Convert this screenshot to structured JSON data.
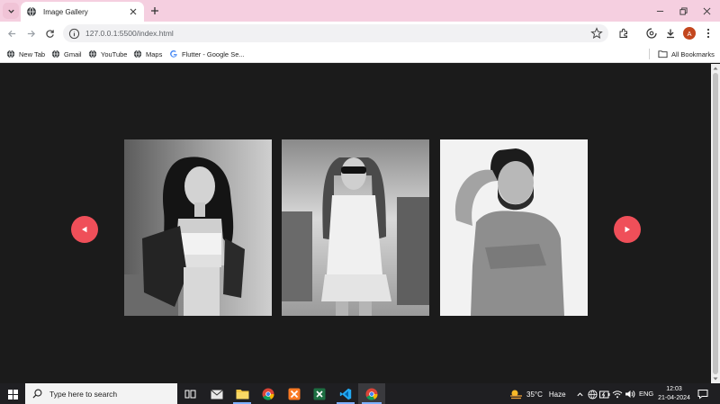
{
  "browser": {
    "tab": {
      "title": "Image Gallery"
    },
    "address": {
      "url": "127.0.0.1:5500/index.html"
    },
    "profile_initial": "A",
    "bookmarks": [
      {
        "label": "New Tab",
        "icon": "globe-icon"
      },
      {
        "label": "Gmail",
        "icon": "globe-icon"
      },
      {
        "label": "YouTube",
        "icon": "globe-icon"
      },
      {
        "label": "Maps",
        "icon": "globe-icon"
      },
      {
        "label": "Flutter - Google Se...",
        "icon": "google-icon"
      }
    ],
    "all_bookmarks_label": "All Bookmarks"
  },
  "gallery": {
    "photos": [
      {
        "name": "woman-curly-hair"
      },
      {
        "name": "woman-sunglasses"
      },
      {
        "name": "man-beard"
      }
    ],
    "accent_color": "#ef4f59"
  },
  "taskbar": {
    "search_placeholder": "Type here to search",
    "weather": {
      "temp": "35°C",
      "condition": "Haze"
    },
    "language": "ENG",
    "time": "12:03",
    "date": "21-04-2024"
  }
}
